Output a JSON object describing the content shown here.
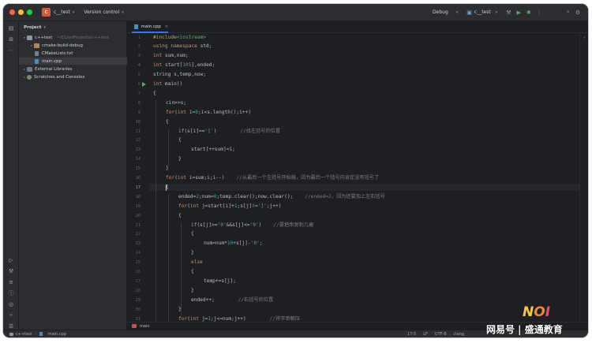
{
  "titlebar": {
    "badge": "C",
    "project_name": "c__test",
    "vcs_label": "Version control",
    "build_config": "Debug",
    "run_config": "c__test"
  },
  "left_strip_icons": [
    "folder-icon",
    "structure-icon",
    "more-icon"
  ],
  "left_strip_bottom_icons": [
    "run-icon",
    "build-icon",
    "terminal-icon",
    "problems-icon",
    "services-icon",
    "git-icon",
    "todo-icon"
  ],
  "project_panel": {
    "title": "Project",
    "items": [
      {
        "label": "c++test",
        "path": "~/CLionProjects/c++test",
        "level": 0,
        "arrow": "▾",
        "icon": "folder",
        "selected": false
      },
      {
        "label": "cmake-build-debug",
        "path": "",
        "level": 1,
        "arrow": "▸",
        "icon": "folder-orange",
        "selected": false
      },
      {
        "label": "CMakeLists.txt",
        "path": "",
        "level": 1,
        "arrow": "",
        "icon": "file",
        "selected": false
      },
      {
        "label": "main.cpp",
        "path": "",
        "level": 1,
        "arrow": "",
        "icon": "cpp",
        "selected": true
      },
      {
        "label": "External Libraries",
        "path": "",
        "level": 0,
        "arrow": "▸",
        "icon": "lib",
        "selected": false
      },
      {
        "label": "Scratches and Consoles",
        "path": "",
        "level": 0,
        "arrow": "▸",
        "icon": "scratch",
        "selected": false
      }
    ]
  },
  "editor": {
    "tab_label": "main.cpp",
    "lines": [
      {
        "n": "1",
        "indent": 0,
        "tokens": [
          [
            "pp",
            "#include"
          ],
          [
            "str",
            "<iostream>"
          ]
        ]
      },
      {
        "n": "2",
        "indent": 0,
        "tokens": [
          [
            "kw",
            "using namespace "
          ],
          [
            "",
            "std;"
          ]
        ]
      },
      {
        "n": "3",
        "indent": 0,
        "tokens": [
          [
            "kw",
            "int "
          ],
          [
            "",
            "sum,num;"
          ]
        ]
      },
      {
        "n": "4",
        "indent": 0,
        "tokens": [
          [
            "kw",
            "int "
          ],
          [
            "",
            "start["
          ],
          [
            "num",
            "105"
          ],
          [
            "",
            "],ended;"
          ]
        ]
      },
      {
        "n": "5",
        "indent": 0,
        "tokens": [
          [
            "",
            "string s,temp,now;"
          ]
        ]
      },
      {
        "n": "6",
        "indent": 0,
        "tokens": [
          [
            "kw",
            "int "
          ],
          [
            "",
            "main()"
          ]
        ]
      },
      {
        "n": "7",
        "indent": 0,
        "tokens": [
          [
            "",
            "{"
          ]
        ]
      },
      {
        "n": "8",
        "indent": 1,
        "tokens": [
          [
            "",
            "cin>>s;"
          ]
        ]
      },
      {
        "n": "9",
        "indent": 1,
        "tokens": [
          [
            "kw",
            "for"
          ],
          [
            "",
            "("
          ],
          [
            "kw",
            "int "
          ],
          [
            "",
            "i="
          ],
          [
            "num",
            "0"
          ],
          [
            "",
            ";i<s.length();i++)"
          ]
        ]
      },
      {
        "n": "10",
        "indent": 1,
        "tokens": [
          [
            "",
            "{"
          ]
        ]
      },
      {
        "n": "11",
        "indent": 2,
        "tokens": [
          [
            "kw",
            "if"
          ],
          [
            "",
            "(s[i]=="
          ],
          [
            "str",
            "'['"
          ],
          [
            "",
            ")        "
          ],
          [
            "cmt",
            "//找左括号的位置"
          ]
        ]
      },
      {
        "n": "12",
        "indent": 2,
        "tokens": [
          [
            "",
            "{"
          ]
        ]
      },
      {
        "n": "13",
        "indent": 3,
        "tokens": [
          [
            "",
            "start[++sum]=i;"
          ]
        ]
      },
      {
        "n": "14",
        "indent": 2,
        "tokens": [
          [
            "",
            "}"
          ]
        ]
      },
      {
        "n": "15",
        "indent": 1,
        "tokens": [
          [
            "",
            "}"
          ]
        ]
      },
      {
        "n": "16",
        "indent": 1,
        "tokens": [
          [
            "kw",
            "for"
          ],
          [
            "",
            "("
          ],
          [
            "kw",
            "int "
          ],
          [
            "",
            "i=sum;i;i--)    "
          ],
          [
            "cmt",
            "//从最后一个左括号开始做，因为最后一个括号内肯定没有括号了"
          ]
        ]
      },
      {
        "n": "17",
        "indent": 1,
        "tokens": [
          [
            "",
            "{"
          ]
        ]
      },
      {
        "n": "18",
        "indent": 2,
        "tokens": [
          [
            "",
            "ended="
          ],
          [
            "num",
            "2"
          ],
          [
            "",
            ";num="
          ],
          [
            "num",
            "0"
          ],
          [
            "",
            ";temp.clear();now.clear();    "
          ],
          [
            "cmt",
            "//ended=2，因为还要加上左右括号"
          ]
        ]
      },
      {
        "n": "19",
        "indent": 2,
        "tokens": [
          [
            "kw",
            "for"
          ],
          [
            "",
            "("
          ],
          [
            "kw",
            "int "
          ],
          [
            "",
            "j=start[i]+"
          ],
          [
            "num",
            "1"
          ],
          [
            "",
            ";s[j]!="
          ],
          [
            "str",
            "']'"
          ],
          [
            "",
            ";j++)"
          ]
        ]
      },
      {
        "n": "20",
        "indent": 2,
        "tokens": [
          [
            "",
            "{"
          ]
        ]
      },
      {
        "n": "21",
        "indent": 3,
        "tokens": [
          [
            "kw",
            "if"
          ],
          [
            "",
            "(s[j]>="
          ],
          [
            "str",
            "'0'"
          ],
          [
            "",
            "&&s[j]<="
          ],
          [
            "str",
            "'9'"
          ],
          [
            "",
            ")    "
          ],
          [
            "cmt",
            "//要把串复制几遍"
          ]
        ]
      },
      {
        "n": "22",
        "indent": 3,
        "tokens": [
          [
            "",
            "{"
          ]
        ]
      },
      {
        "n": "23",
        "indent": 4,
        "tokens": [
          [
            "",
            "num=num*"
          ],
          [
            "num",
            "10"
          ],
          [
            "",
            "+s[j]-"
          ],
          [
            "str",
            "'0'"
          ],
          [
            "",
            ";"
          ]
        ]
      },
      {
        "n": "24",
        "indent": 3,
        "tokens": [
          [
            "",
            "}"
          ]
        ]
      },
      {
        "n": "25",
        "indent": 3,
        "tokens": [
          [
            "kw",
            "else"
          ]
        ]
      },
      {
        "n": "26",
        "indent": 3,
        "tokens": [
          [
            "",
            "{"
          ]
        ]
      },
      {
        "n": "27",
        "indent": 4,
        "tokens": [
          [
            "",
            "temp+=s[j];"
          ]
        ]
      },
      {
        "n": "28",
        "indent": 3,
        "tokens": [
          [
            "",
            "}"
          ]
        ]
      },
      {
        "n": "29",
        "indent": 3,
        "tokens": [
          [
            "",
            "ended++;        "
          ],
          [
            "cmt",
            "//右括号的位置"
          ]
        ]
      },
      {
        "n": "30",
        "indent": 2,
        "tokens": [
          [
            "",
            "}"
          ]
        ]
      },
      {
        "n": "31",
        "indent": 2,
        "tokens": [
          [
            "kw",
            "for"
          ],
          [
            "",
            "("
          ],
          [
            "kw",
            "int "
          ],
          [
            "",
            "j="
          ],
          [
            "num",
            "1"
          ],
          [
            "",
            ";j<=num;j++)        "
          ],
          [
            "cmt",
            "//将字串解压"
          ]
        ]
      }
    ]
  },
  "runbar": {
    "label": "main"
  },
  "statusbar": {
    "crumbs": [
      "c++test",
      "main.cpp"
    ],
    "right": [
      "17:5",
      "LF",
      "UTF-8",
      "clang"
    ]
  },
  "watermark": {
    "logo_letters": [
      "N",
      "O",
      "I"
    ],
    "text": "网易号 | 盛通教育"
  }
}
